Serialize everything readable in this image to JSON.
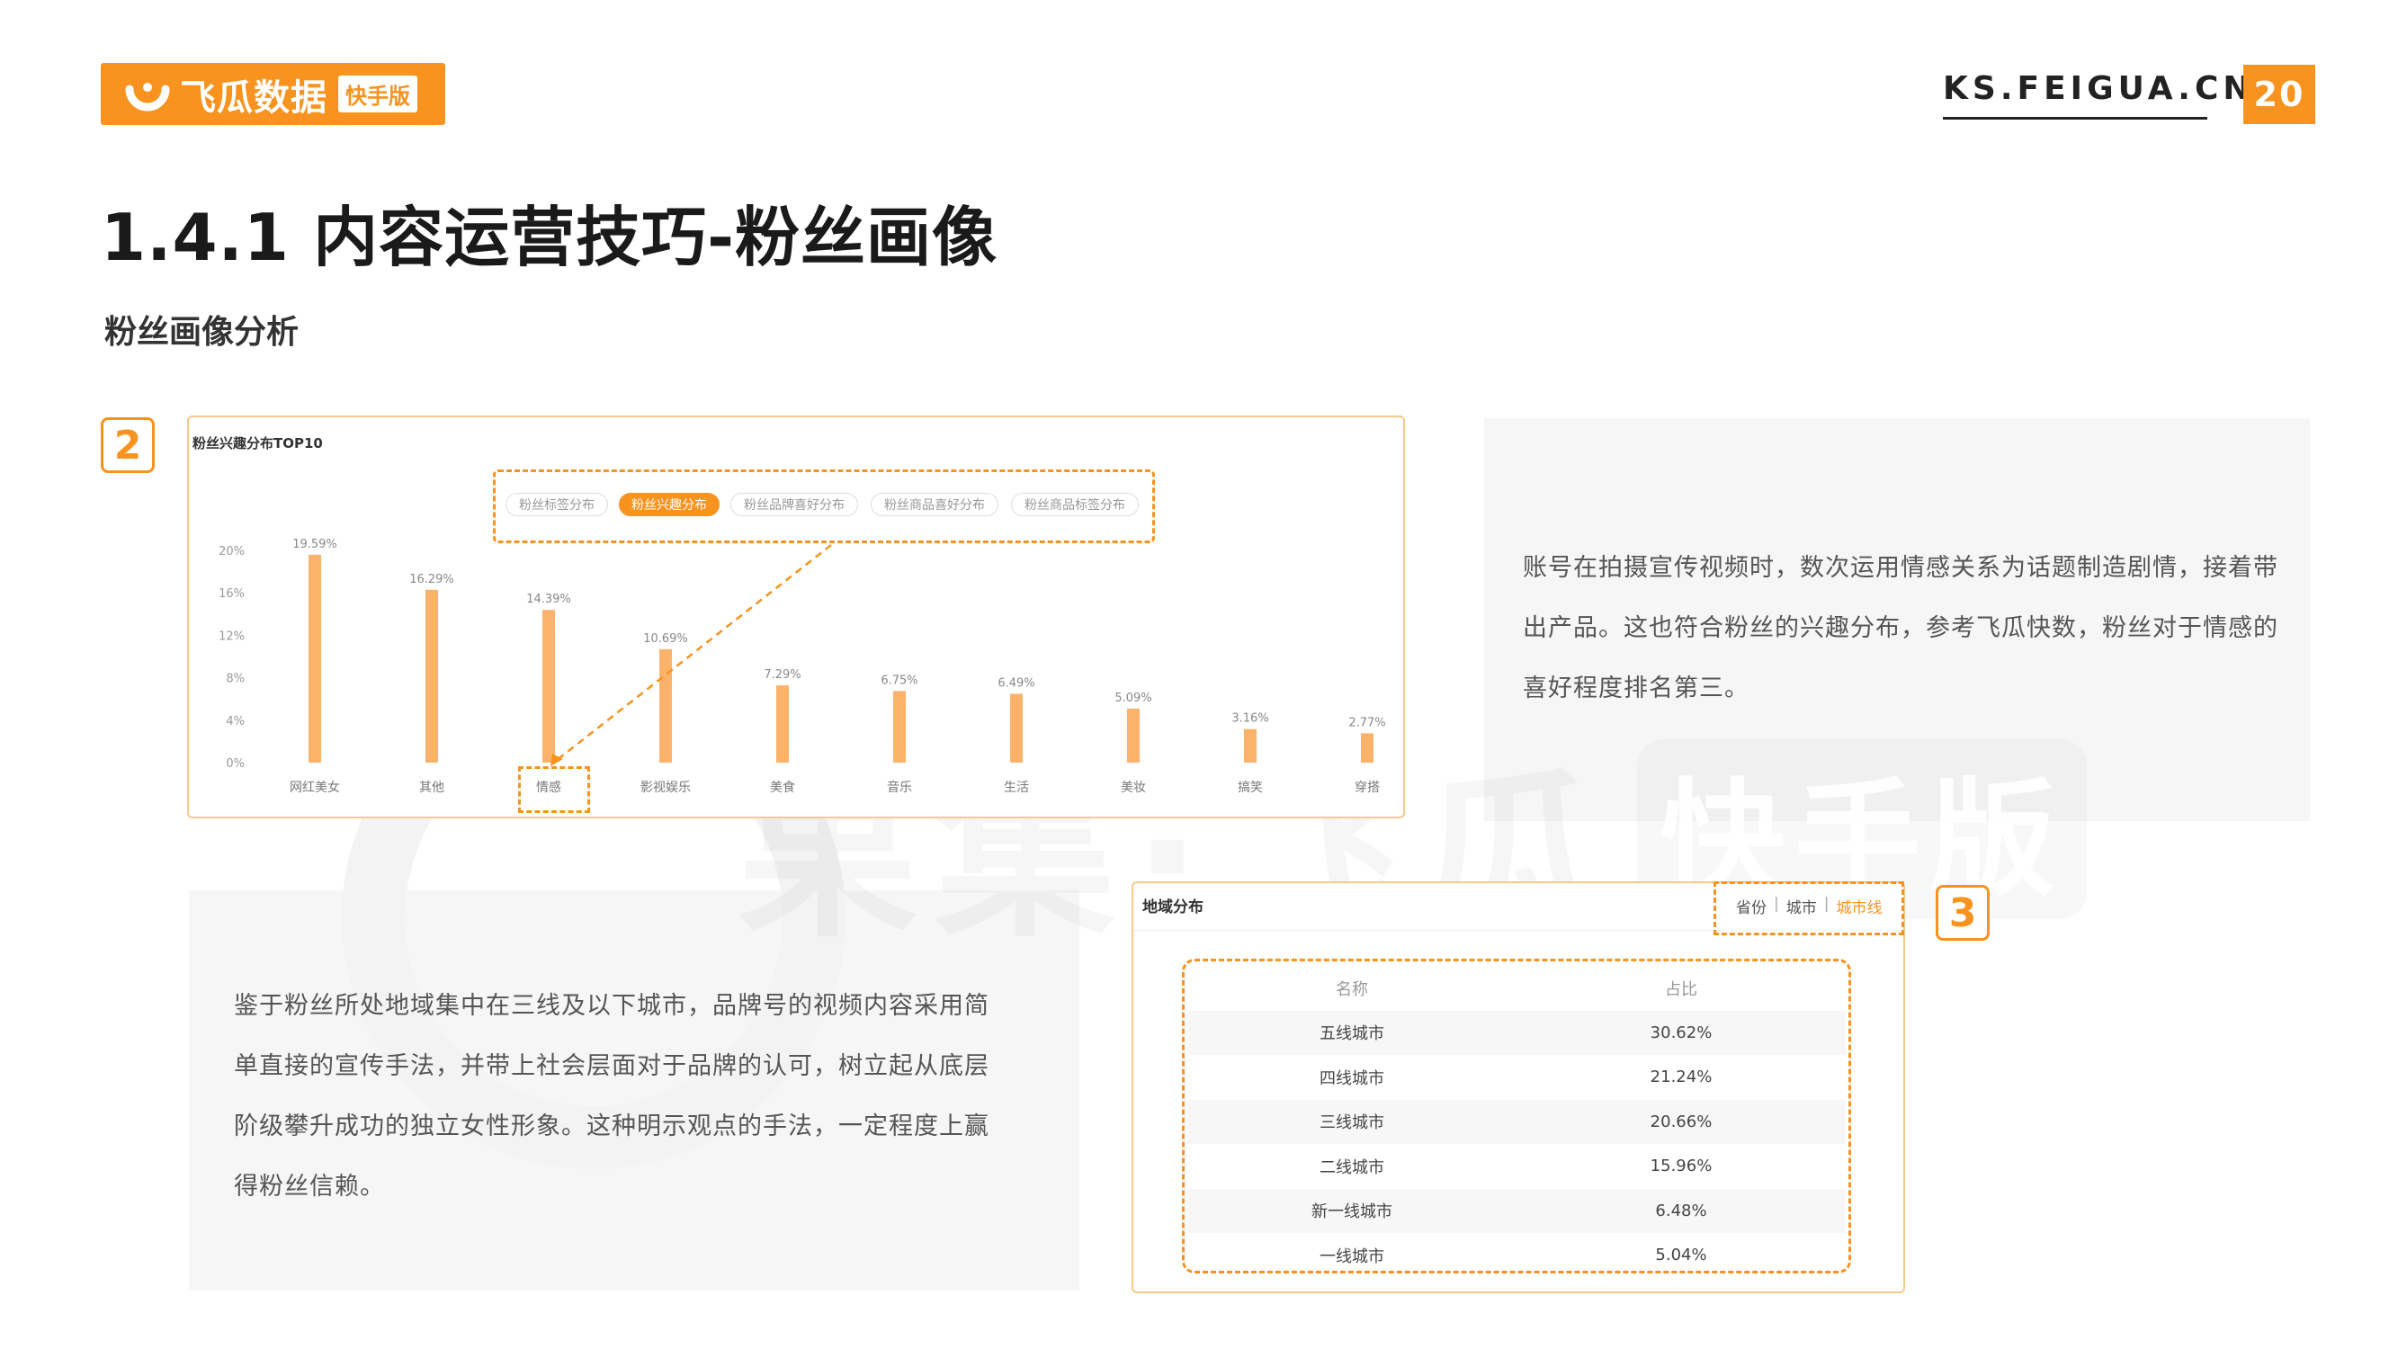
{
  "header": {
    "brand": "飞瓜数据",
    "brand_badge": "快手版",
    "site": "KS.FEIGUA.CN",
    "page_number": "20",
    "brand_color": "#f7931e"
  },
  "title": "1.4.1 内容运营技巧-粉丝画像",
  "subtitle": "粉丝画像分析",
  "watermark": {
    "text": "果集·飞瓜",
    "badge": "快手版"
  },
  "markers": [
    "2",
    "3"
  ],
  "interest_card": {
    "title": "粉丝兴趣分布TOP10",
    "tabs": [
      {
        "label": "粉丝标签分布",
        "active": false
      },
      {
        "label": "粉丝兴趣分布",
        "active": true
      },
      {
        "label": "粉丝品牌喜好分布",
        "active": false
      },
      {
        "label": "粉丝商品喜好分布",
        "active": false
      },
      {
        "label": "粉丝商品标签分布",
        "active": false
      }
    ]
  },
  "chart_data": {
    "type": "bar",
    "title": "粉丝兴趣分布TOP10",
    "categories": [
      "网红美女",
      "其他",
      "情感",
      "影视娱乐",
      "美食",
      "音乐",
      "生活",
      "美妆",
      "搞笑",
      "穿搭"
    ],
    "values": [
      19.59,
      16.29,
      14.39,
      10.69,
      7.29,
      6.75,
      6.49,
      5.09,
      3.16,
      2.77
    ],
    "data_labels": [
      "19.59%",
      "16.29%",
      "14.39%",
      "10.69%",
      "7.29%",
      "6.75%",
      "6.49%",
      "5.09%",
      "3.16%",
      "2.77%"
    ],
    "yticks": [
      "0%",
      "4%",
      "8%",
      "12%",
      "16%",
      "20%"
    ],
    "ylim": [
      0,
      20
    ],
    "highlight_category": "情感",
    "bar_color": "#fbb36b",
    "grid": false
  },
  "paragraph_right": "账号在拍摄宣传视频时，数次运用情感关系为话题制造剧情，接着带出产品。这也符合粉丝的兴趣分布，参考飞瓜快数，粉丝对于情感的喜好程度排名第三。",
  "paragraph_left": "鉴于粉丝所处地域集中在三线及以下城市，品牌号的视频内容采用简单直接的宣传手法，并带上社会层面对于品牌的认可，树立起从底层阶级攀升成功的独立女性形象。这种明示观点的手法，一定程度上赢得粉丝信赖。",
  "region_card": {
    "title": "地域分布",
    "tabs": [
      "省份",
      "城市",
      "城市线"
    ],
    "active_tab": "城市线",
    "columns": [
      "名称",
      "占比"
    ],
    "rows": [
      [
        "五线城市",
        "30.62%"
      ],
      [
        "四线城市",
        "21.24%"
      ],
      [
        "三线城市",
        "20.66%"
      ],
      [
        "二线城市",
        "15.96%"
      ],
      [
        "新一线城市",
        "6.48%"
      ],
      [
        "一线城市",
        "5.04%"
      ]
    ]
  }
}
